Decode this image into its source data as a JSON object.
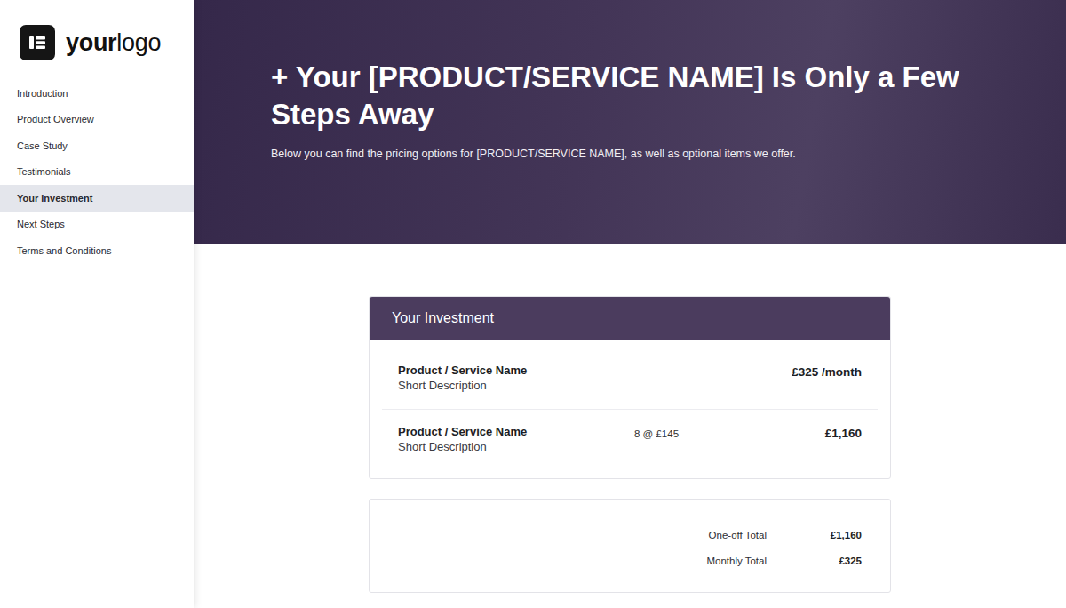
{
  "sidebar": {
    "logo": {
      "part1": "your",
      "part2": "logo"
    },
    "items": [
      {
        "label": "Introduction",
        "selected": false
      },
      {
        "label": "Product Overview",
        "selected": false
      },
      {
        "label": "Case Study",
        "selected": false
      },
      {
        "label": "Testimonials",
        "selected": false
      },
      {
        "label": "Your Investment",
        "selected": true
      },
      {
        "label": "Next Steps",
        "selected": false
      },
      {
        "label": "Terms and Conditions",
        "selected": false
      }
    ]
  },
  "hero": {
    "title": "+ Your [PRODUCT/SERVICE NAME] Is Only a Few Steps Away",
    "subtitle": "Below you can find the pricing options for [PRODUCT/SERVICE NAME], as well as optional items we offer."
  },
  "investment": {
    "title": "Your Investment",
    "items": [
      {
        "name": "Product / Service Name",
        "description": "Short Description",
        "price": "£325 /month"
      },
      {
        "name": "Product / Service Name",
        "description": "Short Description",
        "quantity": "8 @ £145",
        "price": "£1,160"
      }
    ]
  },
  "totals": [
    {
      "label": "One-off Total",
      "value": "£1,160"
    },
    {
      "label": "Monthly Total",
      "value": "£325"
    }
  ]
}
